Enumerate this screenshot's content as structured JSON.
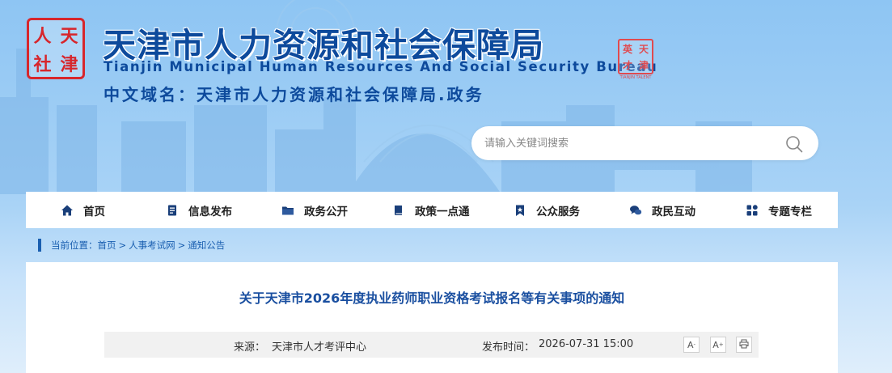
{
  "header": {
    "seal_chars": [
      "人",
      "天",
      "社",
      "津"
    ],
    "title": "天津市人力资源和社会保障局",
    "subtitle": "Tianjin Municipal Human Resources And Social Security Bureau",
    "domain": "中文域名：天津市人力资源和社会保障局.政务",
    "stamp_chars": [
      "天",
      "津",
      "英",
      "才"
    ],
    "stamp_caption": "TIANJIN TALENT"
  },
  "search": {
    "placeholder": "请输入关键词搜索",
    "icon": "search-icon"
  },
  "nav": {
    "items": [
      {
        "label": "首页",
        "icon": "home-icon"
      },
      {
        "label": "信息发布",
        "icon": "document-icon"
      },
      {
        "label": "政务公开",
        "icon": "folder-icon"
      },
      {
        "label": "政策一点通",
        "icon": "book-icon"
      },
      {
        "label": "公众服务",
        "icon": "bookmark-star-icon"
      },
      {
        "label": "政民互动",
        "icon": "chat-icon"
      },
      {
        "label": "专题专栏",
        "icon": "grid-icon"
      }
    ]
  },
  "breadcrumb": {
    "prefix": "当前位置：",
    "items": [
      "首页",
      "人事考试网",
      "通知公告"
    ],
    "separator": ">"
  },
  "article": {
    "title": "关于天津市2026年度执业药师职业资格考试报名等有关事项的通知",
    "source_label": "来源：",
    "source": "天津市人才考评中心",
    "date_label": "发布时间：",
    "date": "2026-07-31 15:00",
    "tools": {
      "font_smaller": "A",
      "font_larger": "A",
      "minus": "-",
      "plus": "+"
    }
  },
  "colors": {
    "brand_blue": "#0d4a9c",
    "link_blue": "#1a5fb0",
    "seal_red": "#d7262c"
  }
}
